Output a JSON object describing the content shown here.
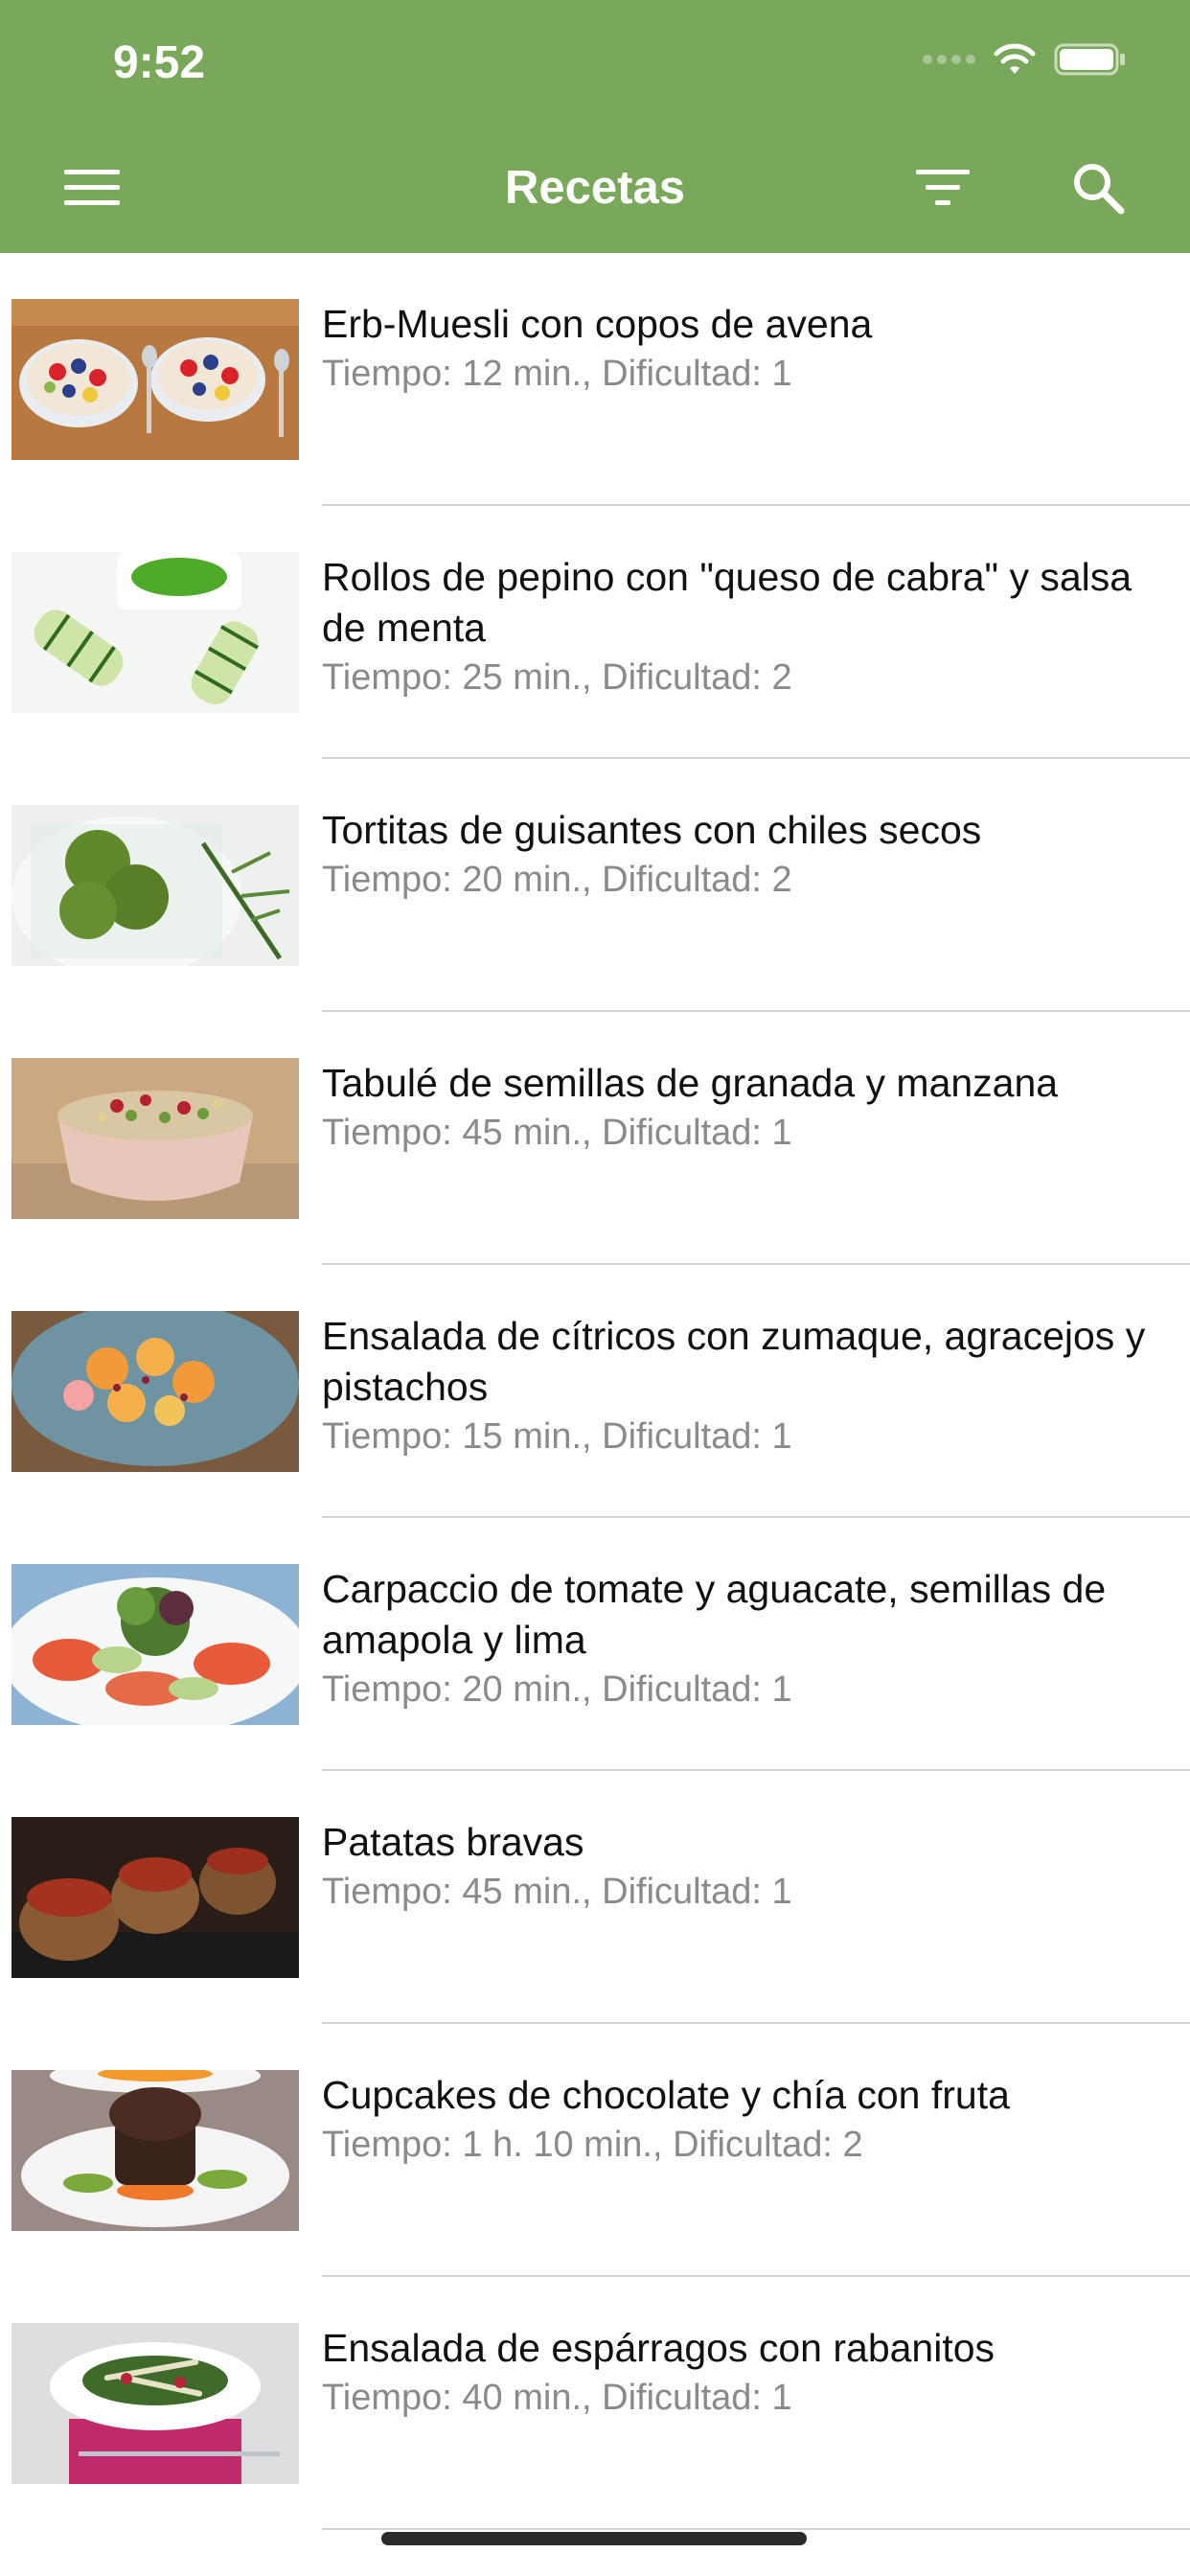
{
  "status_bar": {
    "time": "9:52"
  },
  "nav": {
    "title": "Recetas"
  },
  "recipes": [
    {
      "title": "Erb-Muesli con copos de avena",
      "meta": "Tiempo: 12 min., Dificultad: 1"
    },
    {
      "title": "Rollos de pepino con \"queso de cabra\" y salsa de menta",
      "meta": "Tiempo: 25 min., Dificultad: 2"
    },
    {
      "title": "Tortitas de guisantes con chiles secos",
      "meta": "Tiempo: 20 min., Dificultad: 2"
    },
    {
      "title": "Tabulé de semillas de granada y manzana",
      "meta": "Tiempo: 45 min., Dificultad: 1"
    },
    {
      "title": "Ensalada de cítricos con zumaque, agracejos y pistachos",
      "meta": "Tiempo: 15 min., Dificultad: 1"
    },
    {
      "title": "Carpaccio de tomate y aguacate, semillas de amapola y lima",
      "meta": "Tiempo: 20 min., Dificultad: 1"
    },
    {
      "title": "Patatas bravas",
      "meta": "Tiempo: 45 min., Dificultad: 1"
    },
    {
      "title": "Cupcakes de chocolate y chía con fruta",
      "meta": "Tiempo: 1 h. 10 min., Dificultad: 2"
    },
    {
      "title": "Ensalada de espárragos con rabanitos",
      "meta": "Tiempo: 40 min., Dificultad: 1"
    }
  ],
  "colors": {
    "header": "#7aa85a",
    "text": "#111111",
    "meta": "#8a8a8a",
    "separator": "#d8d8d8"
  }
}
